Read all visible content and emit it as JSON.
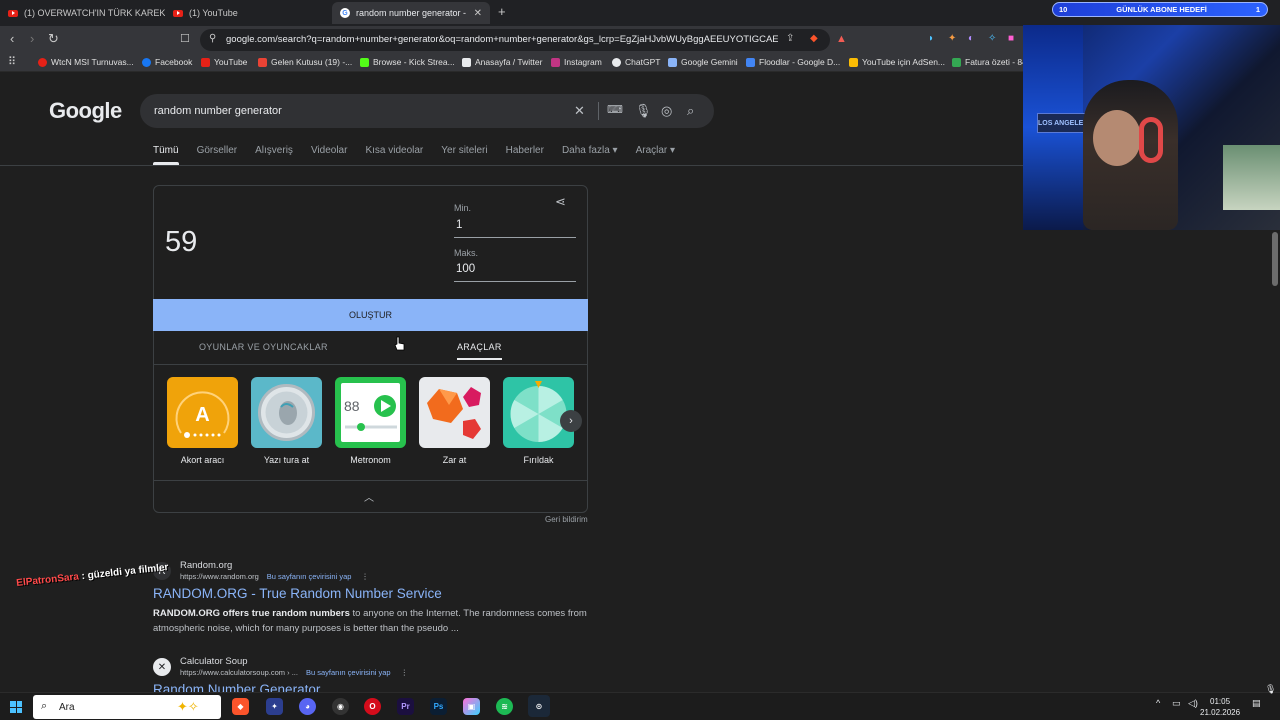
{
  "browser": {
    "tabs": [
      {
        "title": "(1) OVERWATCH'IN TÜRK KAREKTERİ",
        "icon": "youtube-icon",
        "active": false
      },
      {
        "title": "(1) YouTube",
        "icon": "youtube-icon",
        "active": false
      },
      {
        "title": "random number generator - Goo",
        "icon": "google-icon",
        "active": true
      }
    ],
    "new_tab": "+",
    "url": "google.com/search?q=random+number+generator&oq=random+number+generator&gs_lcrp=EgZjaHJvbWUyBggAEEUYOTIGCAE...",
    "bookmarks": [
      {
        "label": "WtcN MSI Turnuvas...",
        "color": "#e62117"
      },
      {
        "label": "Facebook",
        "color": "#1877f2"
      },
      {
        "label": "YouTube",
        "color": "#e62117"
      },
      {
        "label": "Gelen Kutusu (19) -...",
        "color": "#ea4335"
      },
      {
        "label": "Browse - Kick Strea...",
        "color": "#53fc18"
      },
      {
        "label": "Anasayfa / Twitter",
        "color": "#e8eaed"
      },
      {
        "label": "Instagram",
        "color": "#c13584"
      },
      {
        "label": "ChatGPT",
        "color": "#e8eaed"
      },
      {
        "label": "Google Gemini",
        "color": "#8ab4f8"
      },
      {
        "label": "Floodlar - Google D...",
        "color": "#4285f4"
      },
      {
        "label": "YouTube için AdSen...",
        "color": "#fbbc04"
      },
      {
        "label": "Fatura özeti - 84",
        "color": "#34a853"
      }
    ]
  },
  "google": {
    "logo": "Google",
    "query": "random number generator",
    "tabs": [
      "Tümü",
      "Görseller",
      "Alışveriş",
      "Videolar",
      "Kısa videolar",
      "Yer siteleri",
      "Haberler",
      "Daha fazla ▾",
      "Araçlar ▾"
    ],
    "rng": {
      "result": "59",
      "min_label": "Min.",
      "min_value": "1",
      "max_label": "Maks.",
      "max_value": "100",
      "button": "OLUŞTUR",
      "subtab_games": "OYUNLAR VE OYUNCAKLAR",
      "subtab_tools": "ARAÇLAR",
      "tools": [
        "Akort aracı",
        "Yazı tura at",
        "Metronom",
        "Zar at",
        "Fırıldak"
      ],
      "metronome_value": "88",
      "tuner_letter": "A",
      "feedback": "Geri bildirim"
    },
    "results": [
      {
        "site": "Random.org",
        "favicon": "R",
        "url": "https://www.random.org",
        "translate": "Bu sayfanın çevirisini yap",
        "title": "RANDOM.ORG - True Random Number Service",
        "snippet_bold": "RANDOM.ORG offers true random numbers",
        "snippet": " to anyone on the Internet. The randomness comes from atmospheric noise, which for many purposes is better than the pseudo ..."
      },
      {
        "site": "Calculator Soup",
        "favicon": "✕",
        "url": "https://www.calculatorsoup.com › ...",
        "translate": "Bu sayfanın çevirisini yap",
        "title": "Random Number Generator",
        "snippet_bold": "",
        "snippet": ""
      }
    ]
  },
  "overlay": {
    "goal_count": "10",
    "goal_label": "GÜNLÜK ABONE HEDEFİ",
    "goal_target": "1",
    "chat_user": "ElPatronSara",
    "chat_msg": " : güzeldi ya filmler",
    "webcam_sign": "LOS ANGELES"
  },
  "taskbar": {
    "search_placeholder": "Ara",
    "time": "01:05",
    "date": "21.02.2026"
  }
}
